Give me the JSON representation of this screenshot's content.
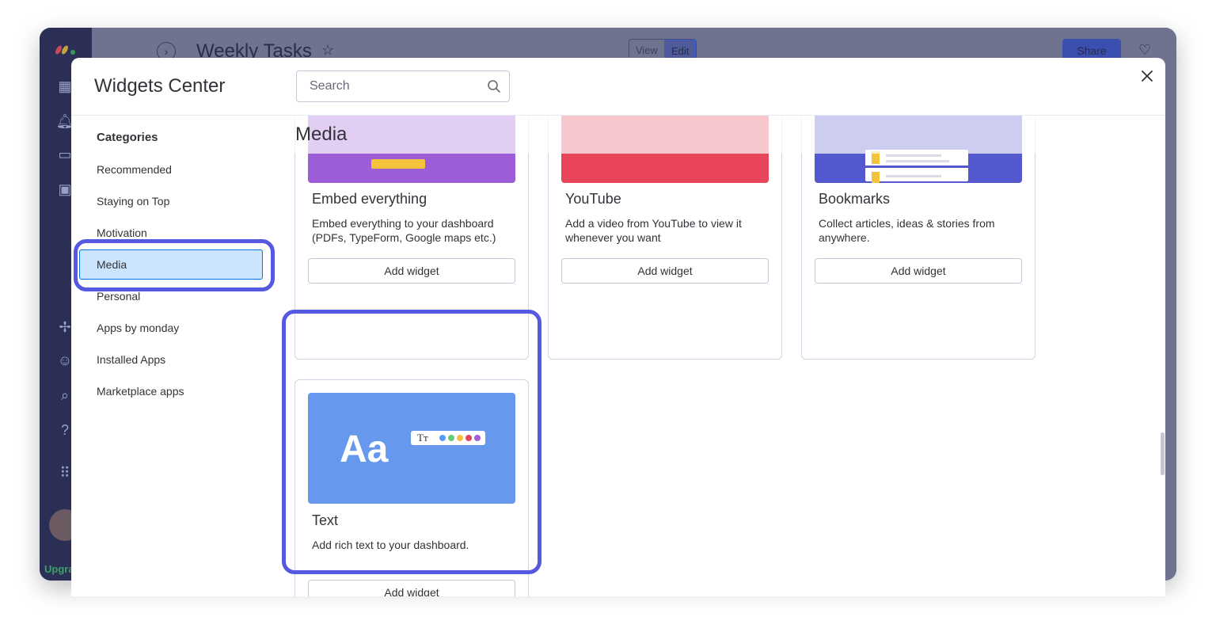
{
  "app": {
    "board_title": "Weekly Tasks",
    "view_label": "View",
    "edit_label": "Edit",
    "share_label": "Share",
    "upgrade_label": "Upgra"
  },
  "modal": {
    "title": "Widgets Center",
    "search_placeholder": "Search",
    "categories_title": "Categories",
    "categories": [
      {
        "label": "Recommended",
        "selected": false
      },
      {
        "label": "Staying on Top",
        "selected": false
      },
      {
        "label": "Motivation",
        "selected": false
      },
      {
        "label": "Media",
        "selected": true
      },
      {
        "label": "Personal",
        "selected": false
      },
      {
        "label": "Apps by monday",
        "selected": false
      },
      {
        "label": "Installed Apps",
        "selected": false
      },
      {
        "label": "Marketplace apps",
        "selected": false
      }
    ],
    "section_title": "Media",
    "widgets": [
      {
        "title": "Embed everything",
        "description": "Embed everything to your dashboard (PDFs, TypeForm, Google maps etc.)",
        "button": "Add widget",
        "thumb_color": "#9d5dd6"
      },
      {
        "title": "YouTube",
        "description": "Add a video from YouTube to view it whenever you want",
        "button": "Add widget",
        "thumb_color": "#e8445a"
      },
      {
        "title": "Bookmarks",
        "description": "Collect articles, ideas & stories from anywhere.",
        "button": "Add widget",
        "thumb_color": "#5458cf"
      },
      {
        "title": "Text",
        "description": "Add rich text to your dashboard.",
        "button": "Add widget",
        "thumb_color": "#6699ee",
        "thumb_text": "Aa",
        "thumb_chip": "Tт"
      }
    ]
  },
  "colors": {
    "highlight": "#5559df",
    "selected_bg": "#cce5ff",
    "selected_border": "#0073ea"
  }
}
